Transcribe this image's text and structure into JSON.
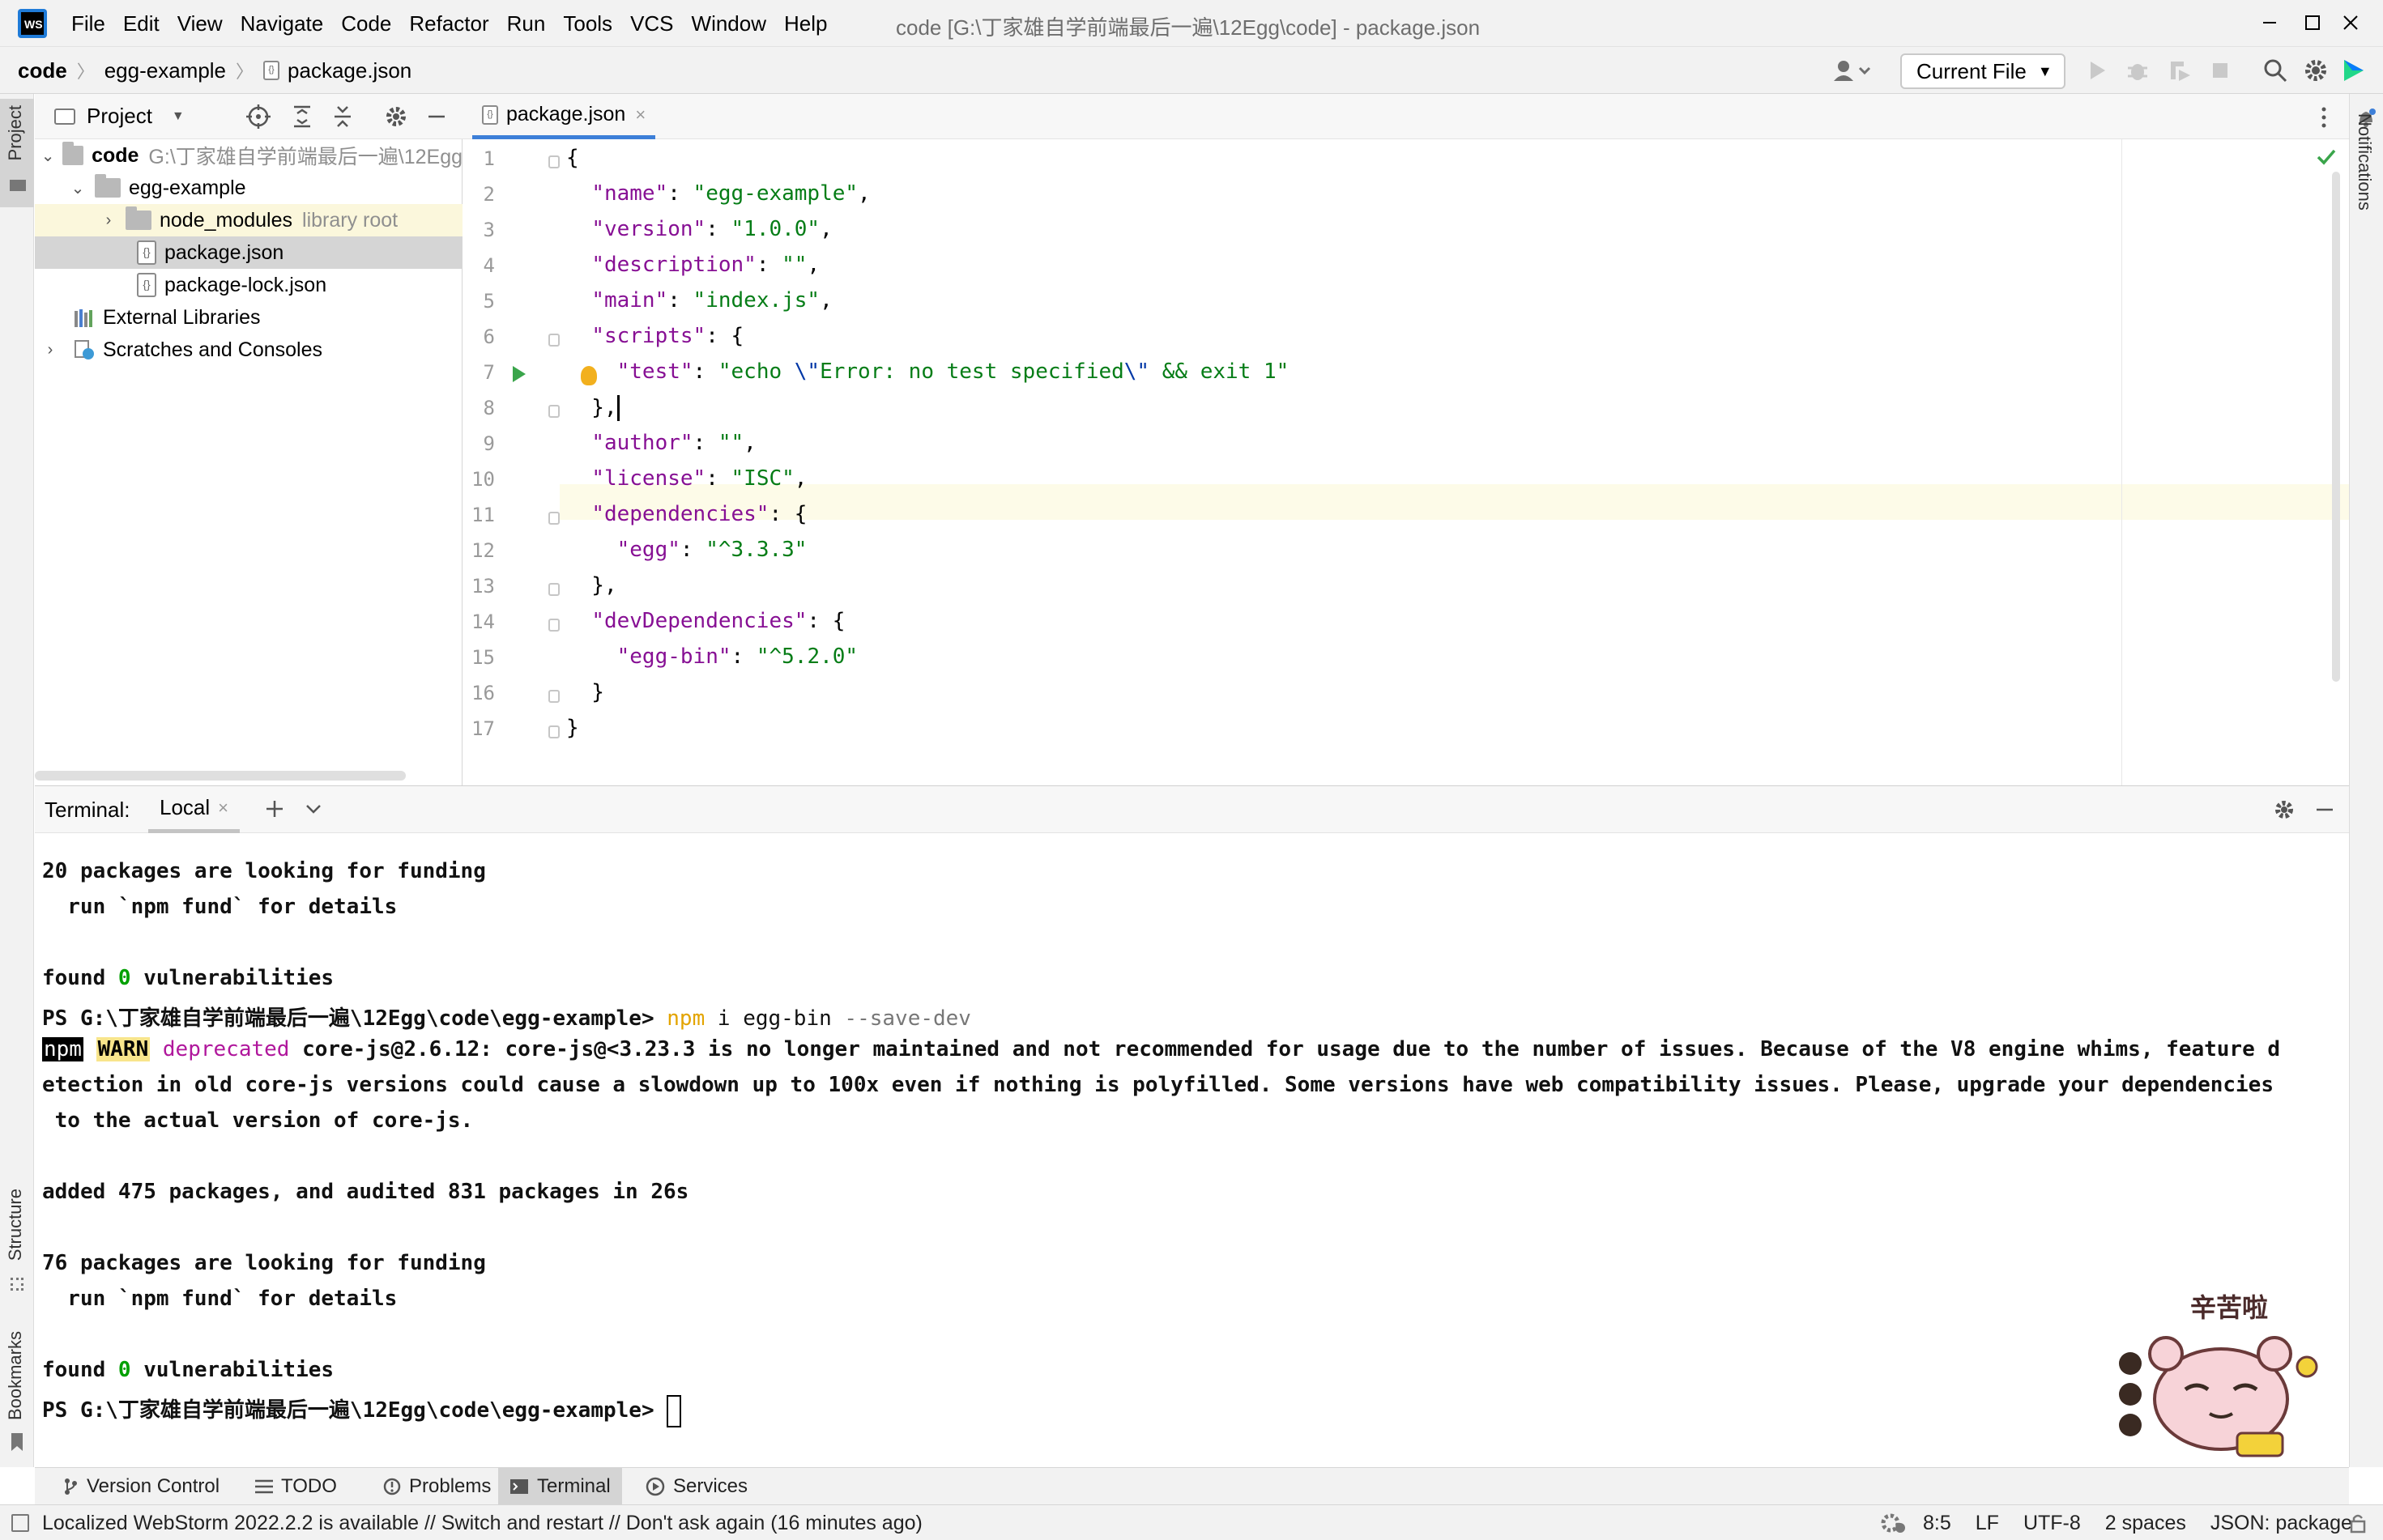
{
  "menu": [
    "File",
    "Edit",
    "View",
    "Navigate",
    "Code",
    "Refactor",
    "Run",
    "Tools",
    "VCS",
    "Window",
    "Help"
  ],
  "window_title": "code [G:\\丁家雄自学前端最后一遍\\12Egg\\code] - package.json",
  "breadcrumb": [
    "code",
    "egg-example",
    "package.json"
  ],
  "run_config": "Current File",
  "left_stripe": {
    "project": "Project",
    "structure": "Structure",
    "bookmarks": "Bookmarks"
  },
  "right_stripe": {
    "notifications": "Notifications"
  },
  "project_panel": {
    "title": "Project",
    "tree": {
      "root_name": "code",
      "root_path": "G:\\丁家雄自学前端最后一遍\\12Egg",
      "egg_example": "egg-example",
      "node_modules": "node_modules",
      "node_modules_note": "library root",
      "package_json": "package.json",
      "package_lock": "package-lock.json",
      "external_libraries": "External Libraries",
      "scratches": "Scratches and Consoles"
    }
  },
  "editor": {
    "tab": "package.json",
    "line_numbers": [
      "1",
      "2",
      "3",
      "4",
      "5",
      "6",
      "7",
      "8",
      "9",
      "10",
      "11",
      "12",
      "13",
      "14",
      "15",
      "16",
      "17"
    ],
    "lines": [
      [
        {
          "t": "{",
          "c": ""
        }
      ],
      [
        {
          "t": "  ",
          "c": ""
        },
        {
          "t": "\"name\"",
          "c": "k"
        },
        {
          "t": ": ",
          "c": ""
        },
        {
          "t": "\"egg-example\"",
          "c": "s"
        },
        {
          "t": ",",
          "c": ""
        }
      ],
      [
        {
          "t": "  ",
          "c": ""
        },
        {
          "t": "\"version\"",
          "c": "k"
        },
        {
          "t": ": ",
          "c": ""
        },
        {
          "t": "\"1.0.0\"",
          "c": "s"
        },
        {
          "t": ",",
          "c": ""
        }
      ],
      [
        {
          "t": "  ",
          "c": ""
        },
        {
          "t": "\"description\"",
          "c": "k"
        },
        {
          "t": ": ",
          "c": ""
        },
        {
          "t": "\"\"",
          "c": "s"
        },
        {
          "t": ",",
          "c": ""
        }
      ],
      [
        {
          "t": "  ",
          "c": ""
        },
        {
          "t": "\"main\"",
          "c": "k"
        },
        {
          "t": ": ",
          "c": ""
        },
        {
          "t": "\"index.js\"",
          "c": "s"
        },
        {
          "t": ",",
          "c": ""
        }
      ],
      [
        {
          "t": "  ",
          "c": ""
        },
        {
          "t": "\"scripts\"",
          "c": "k"
        },
        {
          "t": ": {",
          "c": ""
        }
      ],
      [
        {
          "t": "    ",
          "c": ""
        },
        {
          "t": "\"test\"",
          "c": "k"
        },
        {
          "t": ": ",
          "c": ""
        },
        {
          "t": "\"echo ",
          "c": "s"
        },
        {
          "t": "\\\"",
          "c": "e"
        },
        {
          "t": "Error: no test specified",
          "c": "s"
        },
        {
          "t": "\\\"",
          "c": "e"
        },
        {
          "t": " && exit 1\"",
          "c": "s"
        }
      ],
      [
        {
          "t": "  },",
          "c": ""
        }
      ],
      [
        {
          "t": "  ",
          "c": ""
        },
        {
          "t": "\"author\"",
          "c": "k"
        },
        {
          "t": ": ",
          "c": ""
        },
        {
          "t": "\"\"",
          "c": "s"
        },
        {
          "t": ",",
          "c": ""
        }
      ],
      [
        {
          "t": "  ",
          "c": ""
        },
        {
          "t": "\"license\"",
          "c": "k"
        },
        {
          "t": ": ",
          "c": ""
        },
        {
          "t": "\"ISC\"",
          "c": "s"
        },
        {
          "t": ",",
          "c": ""
        }
      ],
      [
        {
          "t": "  ",
          "c": ""
        },
        {
          "t": "\"dependencies\"",
          "c": "k"
        },
        {
          "t": ": {",
          "c": ""
        }
      ],
      [
        {
          "t": "    ",
          "c": ""
        },
        {
          "t": "\"egg\"",
          "c": "k"
        },
        {
          "t": ": ",
          "c": ""
        },
        {
          "t": "\"^3.3.3\"",
          "c": "s"
        }
      ],
      [
        {
          "t": "  },",
          "c": ""
        }
      ],
      [
        {
          "t": "  ",
          "c": ""
        },
        {
          "t": "\"devDependencies\"",
          "c": "k"
        },
        {
          "t": ": {",
          "c": ""
        }
      ],
      [
        {
          "t": "    ",
          "c": ""
        },
        {
          "t": "\"egg-bin\"",
          "c": "k"
        },
        {
          "t": ": ",
          "c": ""
        },
        {
          "t": "\"^5.2.0\"",
          "c": "s"
        }
      ],
      [
        {
          "t": "  }",
          "c": ""
        }
      ],
      [
        {
          "t": "}",
          "c": ""
        }
      ]
    ]
  },
  "terminal": {
    "title": "Terminal:",
    "tab": "Local",
    "lines": [
      [
        {
          "t": "20 packages are looking for funding",
          "c": "tb"
        }
      ],
      [
        {
          "t": "  run `npm fund` for details",
          "c": "tb"
        }
      ],
      [
        {
          "t": "",
          "c": ""
        }
      ],
      [
        {
          "t": "found ",
          "c": "tb"
        },
        {
          "t": "0",
          "c": "tb green"
        },
        {
          "t": " vulnerabilities",
          "c": "tb"
        }
      ],
      [
        {
          "t": "PS G:\\丁家雄自学前端最后一遍\\12Egg\\code\\egg-example> ",
          "c": "tb"
        },
        {
          "t": "npm",
          "c": "yellowc"
        },
        {
          "t": " i egg-bin ",
          "c": ""
        },
        {
          "t": "--save-dev",
          "c": "grayc"
        }
      ],
      [
        {
          "t": "npm",
          "c": "npmbg"
        },
        {
          "t": " ",
          "c": ""
        },
        {
          "t": "WARN",
          "c": "warnbg"
        },
        {
          "t": " ",
          "c": ""
        },
        {
          "t": "deprecated",
          "c": "mag"
        },
        {
          "t": " core-js@2.6.12: core-js@<3.23.3 is no longer maintained and not recommended for usage due to the number of issues. Because of the V8 engine whims, feature d",
          "c": "tb"
        }
      ],
      [
        {
          "t": "etection in old core-js versions could cause a slowdown up to 100x even if nothing is polyfilled. Some versions have web compatibility issues. Please, upgrade your dependencies",
          "c": "tb"
        }
      ],
      [
        {
          "t": " to the actual version of core-js.",
          "c": "tb"
        }
      ],
      [
        {
          "t": "",
          "c": ""
        }
      ],
      [
        {
          "t": "added 475 packages, and audited 831 packages in 26s",
          "c": "tb"
        }
      ],
      [
        {
          "t": "",
          "c": ""
        }
      ],
      [
        {
          "t": "76 packages are looking for funding",
          "c": "tb"
        }
      ],
      [
        {
          "t": "  run `npm fund` for details",
          "c": "tb"
        }
      ],
      [
        {
          "t": "",
          "c": ""
        }
      ],
      [
        {
          "t": "found ",
          "c": "tb"
        },
        {
          "t": "0",
          "c": "tb green"
        },
        {
          "t": " vulnerabilities",
          "c": "tb"
        }
      ],
      [
        {
          "t": "PS G:\\丁家雄自学前端最后一遍\\12Egg\\code\\egg-example> ",
          "c": "tb"
        }
      ]
    ]
  },
  "tool_tabs": [
    "Version Control",
    "TODO",
    "Problems",
    "Terminal",
    "Services"
  ],
  "status": {
    "message": "Localized WebStorm 2022.2.2 is available // Switch and restart // Don't ask again (16 minutes ago)",
    "position": "8:5",
    "line_sep": "LF",
    "encoding": "UTF-8",
    "indent": "2 spaces",
    "schema": "JSON: package"
  },
  "sticker": {
    "caption": "辛苦啦"
  },
  "colors": {
    "key": "#871094",
    "string": "#067d17",
    "escape": "#0037a6",
    "caret_line": "#fdfbe8",
    "tab_underline": "#3d7fd8",
    "vuln_zero": "#00a000",
    "npm_cmd": "#e3a400"
  }
}
